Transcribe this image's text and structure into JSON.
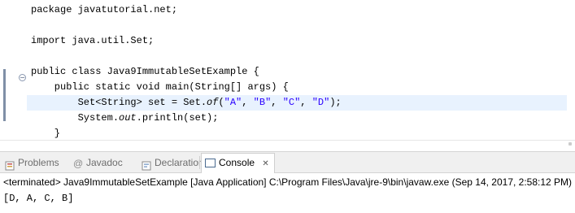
{
  "editor": {
    "lines": [
      {
        "parts": [
          {
            "t": "package javatutorial.net;",
            "c": "kw"
          }
        ]
      },
      {
        "parts": []
      },
      {
        "parts": [
          {
            "t": "import java.util.Set;",
            "c": "kw"
          }
        ]
      },
      {
        "parts": []
      },
      {
        "parts": [
          {
            "t": "public class Java9ImmutableSetExample {",
            "c": "kw"
          }
        ]
      },
      {
        "parts": [
          {
            "t": "    public static void main(String[] args) {",
            "c": "kw"
          }
        ]
      },
      {
        "parts": [
          {
            "t": "        Set<String> set = Set.",
            "c": "kw"
          },
          {
            "t": "of",
            "c": "ital"
          },
          {
            "t": "(",
            "c": "kw"
          },
          {
            "t": "\"A\"",
            "c": "str"
          },
          {
            "t": ", ",
            "c": "kw"
          },
          {
            "t": "\"B\"",
            "c": "str"
          },
          {
            "t": ", ",
            "c": "kw"
          },
          {
            "t": "\"C\"",
            "c": "str"
          },
          {
            "t": ", ",
            "c": "kw"
          },
          {
            "t": "\"D\"",
            "c": "str"
          },
          {
            "t": ");",
            "c": "kw"
          }
        ]
      },
      {
        "parts": [
          {
            "t": "        System.",
            "c": "kw"
          },
          {
            "t": "out",
            "c": "ital"
          },
          {
            "t": ".println(set);",
            "c": "kw"
          }
        ]
      },
      {
        "parts": [
          {
            "t": "    }",
            "c": "kw"
          }
        ]
      },
      {
        "parts": [
          {
            "t": "}",
            "c": "kw"
          }
        ]
      }
    ],
    "fold_icon": "minus"
  },
  "tabs": {
    "problems": {
      "label": "Problems",
      "icon": "problems-icon"
    },
    "javadoc": {
      "label": "Javadoc",
      "icon": "at-icon"
    },
    "declaration": {
      "label": "Declaration",
      "icon": "declaration-icon"
    },
    "console": {
      "label": "Console",
      "icon": "console-icon",
      "close": "✕"
    }
  },
  "console": {
    "header": "<terminated> Java9ImmutableSetExample [Java Application] C:\\Program Files\\Java\\jre-9\\bin\\javaw.exe (Sep 14, 2017, 2:58:12 PM)",
    "output": "[D, A, C, B]"
  },
  "colors": {
    "string_literal": "#2a00ff",
    "current_line_highlight": "#e8f2fe",
    "tabbar_bg": "#f0f0f0"
  }
}
